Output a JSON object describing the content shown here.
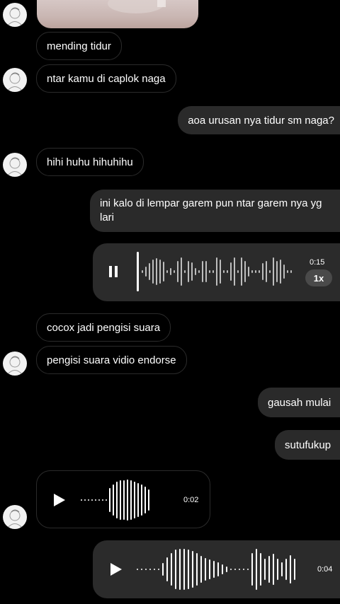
{
  "messages": {
    "m1": "mending tidur",
    "m2": "ntar kamu di caplok naga",
    "m3": "aoa urusan nya tidur sm naga?",
    "m4": "hihi huhu hihuhihu",
    "m5": "ini kalo di lempar garem pun ntar garem nya yg lari",
    "m6": "cocox jadi pengisi suara",
    "m7": "pengisi suara vidio endorse",
    "m8": "gausah mulai",
    "m9": "sutufukup"
  },
  "voice_notes": {
    "v1": {
      "duration": "0:15",
      "speed": "1x",
      "state": "pause-icon"
    },
    "v2": {
      "duration": "0:02",
      "state": "play-icon"
    },
    "v3": {
      "duration": "0:04",
      "state": "play-icon"
    }
  },
  "colors": {
    "background": "#000000",
    "bubble_outgoing": "#2a2a2a",
    "bubble_incoming_border": "#2b2b2b",
    "text": "#ffffff",
    "speed_pill": "#4a4a4a"
  }
}
